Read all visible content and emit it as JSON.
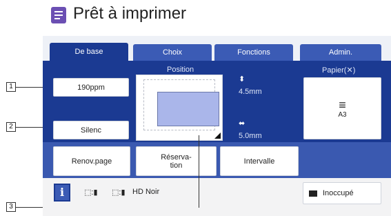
{
  "title": "Prêt à imprimer",
  "tabs": [
    {
      "label": "De base",
      "active": true
    },
    {
      "label": "Choix",
      "active": false
    },
    {
      "label": "Fonctions",
      "active": false
    },
    {
      "label": "Admin.",
      "active": false
    }
  ],
  "main": {
    "speed_button": "190ppm",
    "silent_button": "Silenc",
    "position_label": "Position",
    "vertical_offset": "4.5mm",
    "horizontal_offset": "5.0mm",
    "paper_label": "Papier(",
    "paper_label_end": ")",
    "paper_size": "A3"
  },
  "actions": {
    "renov": "Renov.page",
    "reservation_line1": "Réserva-",
    "reservation_line2": "tion",
    "interval": "Intervalle"
  },
  "status": {
    "info": "i",
    "color_mode": "HD Noir",
    "idle_button": "Inoccupé"
  },
  "callouts": [
    "1",
    "2",
    "3"
  ],
  "colors": {
    "accent_dark": "#1b3a92",
    "accent": "#3b5bb5",
    "title_icon": "#6b4fb3"
  }
}
